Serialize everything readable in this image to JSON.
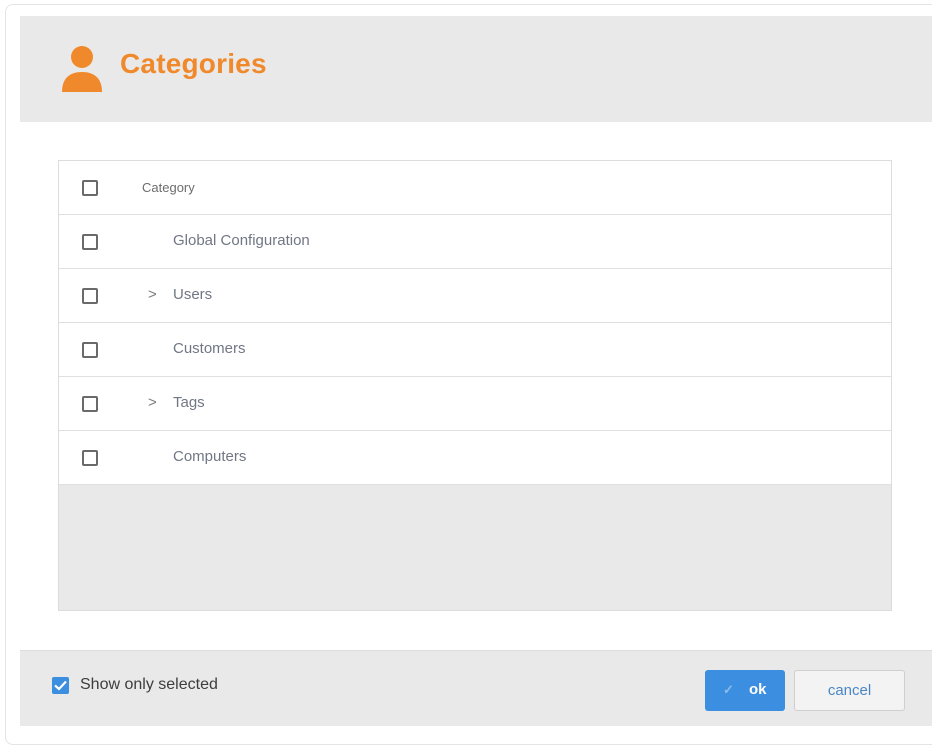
{
  "dialog": {
    "title": "Categories",
    "title_icon": "user-icon",
    "accent_color": "#f0892b"
  },
  "table": {
    "header_label": "Category",
    "rows": [
      {
        "label": "Global Configuration",
        "expandable": false
      },
      {
        "label": "Users",
        "expandable": true
      },
      {
        "label": "Customers",
        "expandable": false
      },
      {
        "label": "Tags",
        "expandable": true
      },
      {
        "label": "Computers",
        "expandable": false
      }
    ],
    "expand_glyph": ">"
  },
  "footer": {
    "show_only_selected_label": "Show only selected",
    "show_only_selected_checked": true,
    "ok_label": "ok",
    "cancel_label": "cancel",
    "primary_color": "#3c8ee0"
  }
}
